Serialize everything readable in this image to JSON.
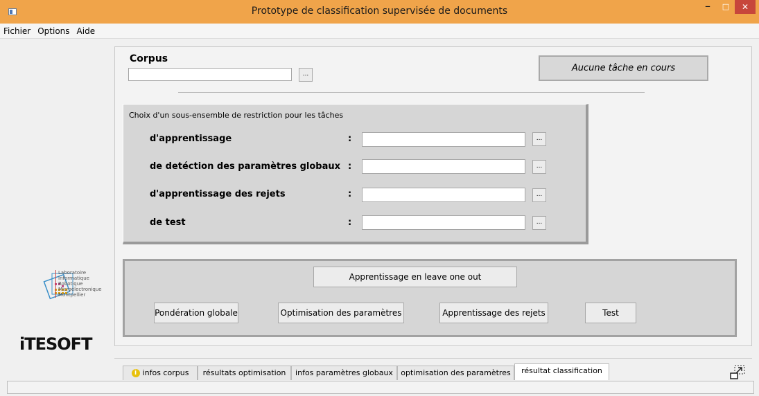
{
  "window": {
    "title": "Prototype de classification supervisée de documents",
    "minimize": "–",
    "maximize": "□",
    "close": "✕"
  },
  "menu": [
    "Fichier",
    "Options",
    "Aide"
  ],
  "corpus": {
    "label": "Corpus",
    "value": "",
    "browse": "..."
  },
  "status": "Aucune tâche en cours",
  "restriction": {
    "title": "Choix d'un sous-ensemble de restriction pour les tâches",
    "rows": [
      {
        "label": "d'apprentissage",
        "colon": ":",
        "value": "",
        "browse": "..."
      },
      {
        "label": "de detéction des paramètres globaux",
        "colon": ":",
        "value": "",
        "browse": "..."
      },
      {
        "label": "d'apprentissage des rejets",
        "colon": ":",
        "value": "",
        "browse": "..."
      },
      {
        "label": "de test",
        "colon": ":",
        "value": "",
        "browse": "..."
      }
    ]
  },
  "actions": {
    "leave_one_out": "Apprentissage en leave one out",
    "ponderation": "Pondération globale",
    "optimisation": "Optimisation des paramètres",
    "rejets": "Apprentissage des rejets",
    "test": "Test"
  },
  "logos": {
    "lirmm_lines": [
      "Laboratoire",
      "Informatique",
      "Robotique",
      "Microélectronique",
      "Montpellier"
    ],
    "itesoft": "iTESOFT"
  },
  "tabs": [
    {
      "label": "infos corpus",
      "icon": "info-icon",
      "active": false
    },
    {
      "label": "résultats optimisation",
      "active": false
    },
    {
      "label": "infos paramètres globaux",
      "active": false
    },
    {
      "label": "optimisation des paramètres",
      "active": false
    },
    {
      "label": "résultat classification",
      "active": true
    }
  ],
  "colors": {
    "titlebar": "#f0a44a",
    "close": "#c7463b",
    "panel": "#d6d6d6"
  }
}
